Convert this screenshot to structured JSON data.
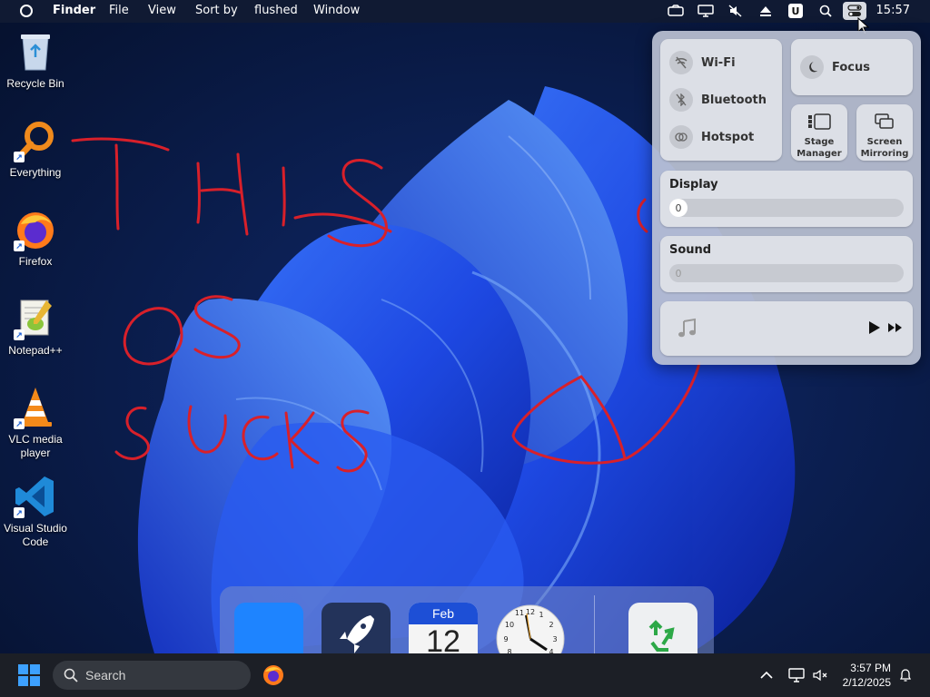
{
  "menubar": {
    "app_name": "Finder",
    "menus": [
      "File",
      "View",
      "Sort by",
      "flushed",
      "Window"
    ],
    "status_icons": [
      "cloud-icon",
      "monitor-icon",
      "mute-icon",
      "eject-icon",
      "u-app-icon",
      "search-icon",
      "control-center-icon"
    ],
    "u_label": "U",
    "time": "15:57"
  },
  "desktop": {
    "icons": [
      {
        "label": "Recycle Bin"
      },
      {
        "label": "Everything"
      },
      {
        "label": "Firefox"
      },
      {
        "label": "Notepad++"
      },
      {
        "label": "VLC media player"
      },
      {
        "label": "Visual Studio Code"
      }
    ],
    "annotation_words": [
      "THIS",
      "OS",
      "SUCKS"
    ]
  },
  "control_center": {
    "wifi_label": "Wi-Fi",
    "bluetooth_label": "Bluetooth",
    "hotspot_label": "Hotspot",
    "focus_label": "Focus",
    "stage_manager_label": [
      "Stage",
      "Manager"
    ],
    "screen_mirroring_label": [
      "Screen",
      "Mirroring"
    ],
    "display_label": "Display",
    "display_value": "0",
    "sound_label": "Sound",
    "sound_value": "0"
  },
  "dock": {
    "items": [
      "finder",
      "launchpad",
      "calendar",
      "clock",
      "trash"
    ],
    "calendar_month": "Feb",
    "calendar_day": "12"
  },
  "taskbar": {
    "search_placeholder": "Search",
    "time": "3:57 PM",
    "date": "2/12/2025"
  },
  "colors": {
    "menubar": "#101a33",
    "wallpaper_bloom": "#2456ff",
    "annotation_red": "#d8202a",
    "windows_blue": "#3da1ff",
    "control_center_bg": "#bac1d2"
  }
}
